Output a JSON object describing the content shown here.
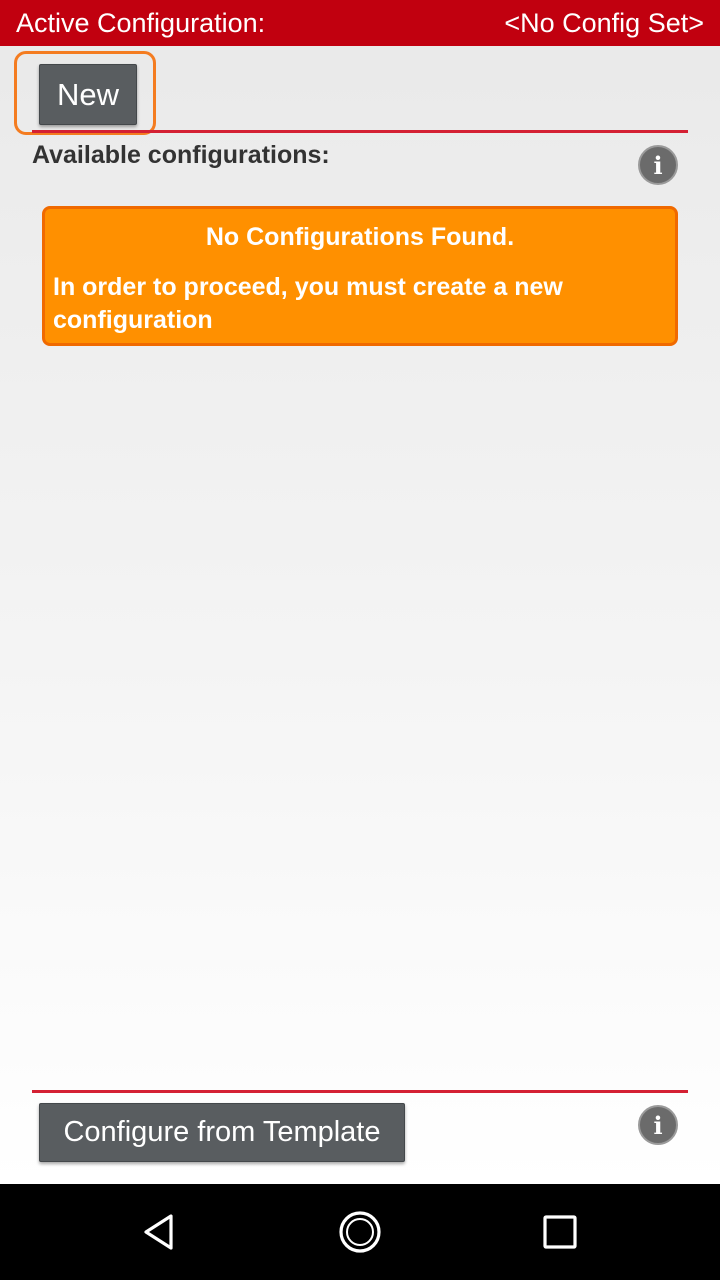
{
  "header": {
    "active_label": "Active Configuration:",
    "active_value": "<No Config Set>"
  },
  "actions": {
    "new_label": "New",
    "template_label": "Configure from Template"
  },
  "configurations": {
    "title": "Available configurations:",
    "items": [],
    "empty_notice": {
      "title": "No Configurations Found.",
      "message": "In order to proceed, you must create a new configuration"
    }
  },
  "icons": {
    "info": "info-icon",
    "back": "back-icon",
    "home": "home-icon",
    "recents": "recents-icon"
  },
  "colors": {
    "header_bg": "#c1000f",
    "accent_line": "#d42033",
    "notice_bg": "#ff9000",
    "focus_ring": "#f47c20",
    "button_bg": "#595d60"
  }
}
